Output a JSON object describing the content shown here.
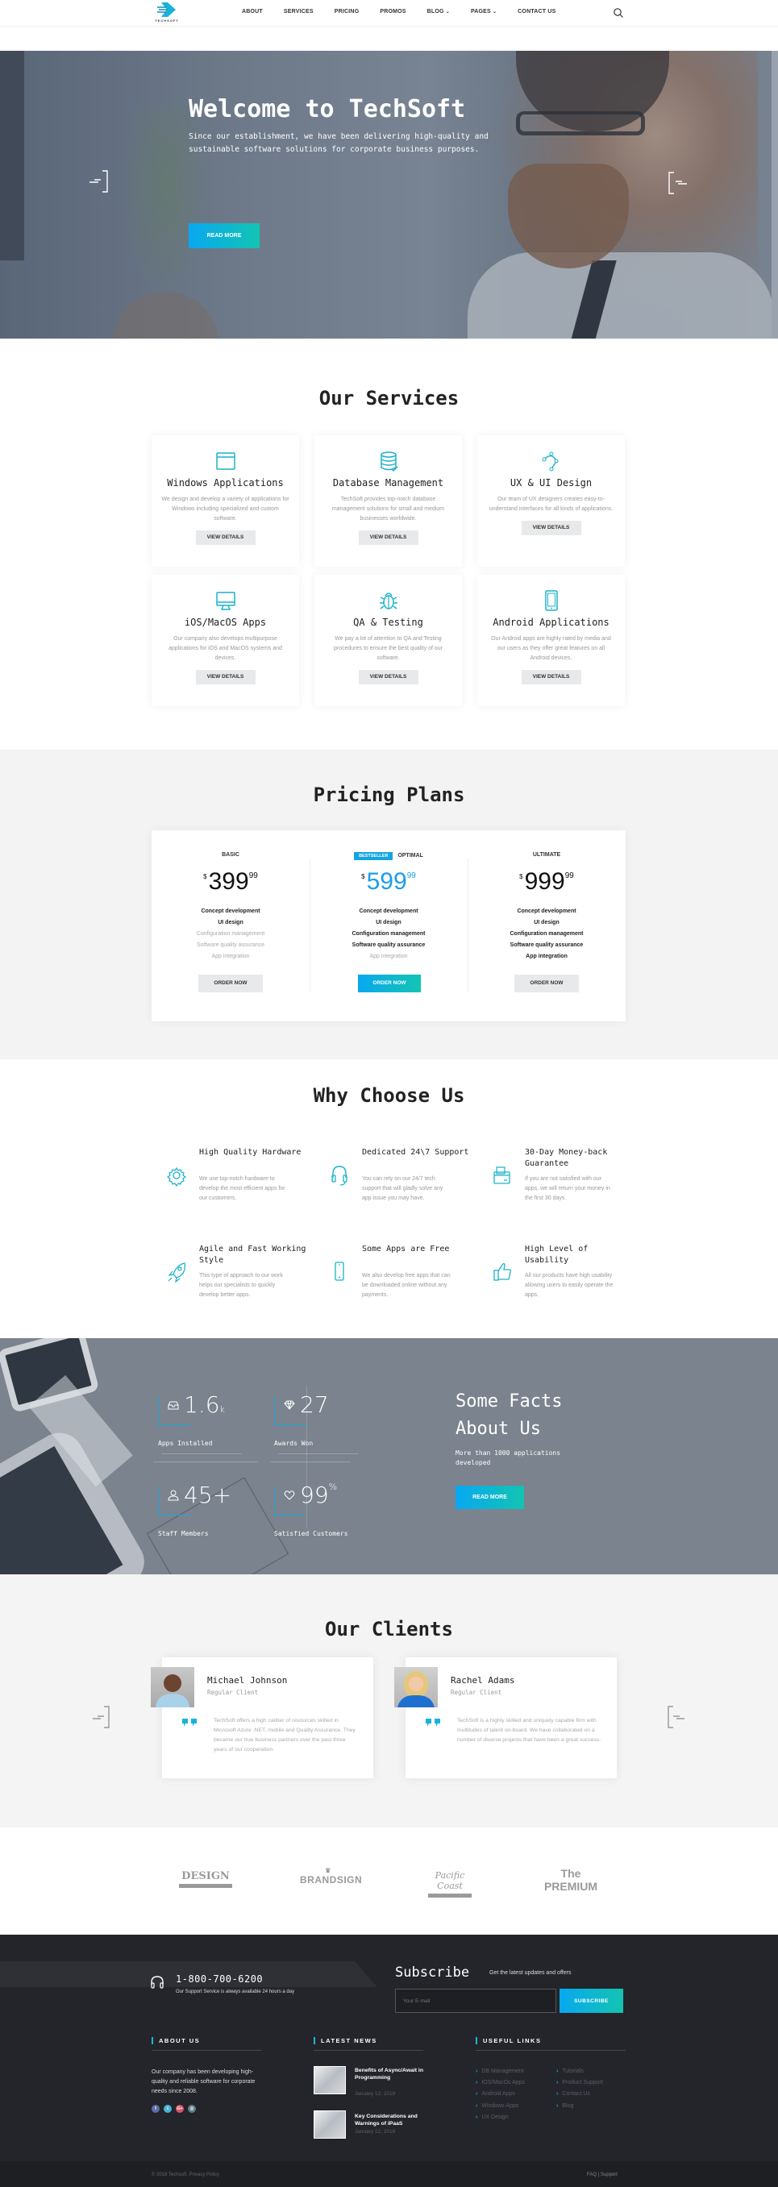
{
  "header": {
    "logo_text": "TECHSOFT",
    "nav": [
      {
        "label": "ABOUT",
        "dropdown": false
      },
      {
        "label": "SERVICES",
        "dropdown": false
      },
      {
        "label": "PRICING",
        "dropdown": false
      },
      {
        "label": "PROMOS",
        "dropdown": false
      },
      {
        "label": "BLOG",
        "dropdown": true
      },
      {
        "label": "PAGES",
        "dropdown": true
      },
      {
        "label": "CONTACT US",
        "dropdown": false
      }
    ],
    "search_icon": "search-icon"
  },
  "hero": {
    "title": "Welcome to TechSoft",
    "text": "Since our establishment, we have been delivering high-quality and sustainable software solutions for corporate business purposes.",
    "button": "READ MORE"
  },
  "services": {
    "title": "Our Services",
    "button_label": "VIEW DETAILS",
    "items": [
      {
        "icon": "window-icon",
        "title": "Windows Applications",
        "desc": "We design and develop a variety of applications for Windows including specialized and custom software."
      },
      {
        "icon": "database-icon",
        "title": "Database Management",
        "desc": "TechSoft provides top-notch database management solutions for small and medium businesses worldwide."
      },
      {
        "icon": "vector-path-icon",
        "title": "UX & UI Design",
        "desc": "Our team of UX designers creates easy-to-understand interfaces for all kinds of applications."
      },
      {
        "icon": "monitor-icon",
        "title": "iOS/MacOS Apps",
        "desc": "Our company also develops multipurpose applications for iOS and MacOS systems and devices."
      },
      {
        "icon": "bug-icon",
        "title": "QA & Testing",
        "desc": "We pay a lot of attention to QA and Testing procedures to ensure the best quality of our software."
      },
      {
        "icon": "tablet-icon",
        "title": "Android Applications",
        "desc": "Our Android apps are highly rated by media and our users as they offer great features on all Android devices."
      }
    ]
  },
  "pricing": {
    "title": "Pricing Plans",
    "currency": "$",
    "order_label": "ORDER NOW",
    "badge": "BESTSELLER",
    "plans": [
      {
        "name": "BASIC",
        "price": "399",
        "cents": "99",
        "highlight": false,
        "features": [
          {
            "label": "Concept development",
            "included": true
          },
          {
            "label": "UI design",
            "included": true
          },
          {
            "label": "Configuration management",
            "included": false
          },
          {
            "label": "Software quality assurance",
            "included": false
          },
          {
            "label": "App integration",
            "included": false
          }
        ]
      },
      {
        "name": "OPTIMAL",
        "price": "599",
        "cents": "99",
        "highlight": true,
        "features": [
          {
            "label": "Concept development",
            "included": true
          },
          {
            "label": "UI design",
            "included": true
          },
          {
            "label": "Configuration management",
            "included": true
          },
          {
            "label": "Software quality assurance",
            "included": true
          },
          {
            "label": "App integration",
            "included": false
          }
        ]
      },
      {
        "name": "ULTIMATE",
        "price": "999",
        "cents": "99",
        "highlight": false,
        "features": [
          {
            "label": "Concept development",
            "included": true
          },
          {
            "label": "UI design",
            "included": true
          },
          {
            "label": "Configuration management",
            "included": true
          },
          {
            "label": "Software quality assurance",
            "included": true
          },
          {
            "label": "App integration",
            "included": true
          }
        ]
      }
    ]
  },
  "why": {
    "title": "Why Choose Us",
    "items": [
      {
        "icon": "gear-icon",
        "title": "High Quality Hardware",
        "desc": "We use top-notch hardware to develop the most efficient apps for our customers."
      },
      {
        "icon": "headset-icon",
        "title": "Dedicated 24\\7 Support",
        "desc": "You can rely on our 24/7 tech support that will gladly solve any app issue you may have."
      },
      {
        "icon": "wallet-icon",
        "title": "30-Day Money-back Guarantee",
        "desc": "If you are not satisfied with our apps, we will return your money in the first 30 days."
      },
      {
        "icon": "rocket-icon",
        "title": "Agile and Fast Working Style",
        "desc": "This type of approach to our work helps our specialists to quickly develop better apps."
      },
      {
        "icon": "smartphone-icon",
        "title": "Some Apps are Free",
        "desc": "We also develop free apps that can be downloaded online without any payments."
      },
      {
        "icon": "thumbs-up-icon",
        "title": "High Level of Usability",
        "desc": "All our products have high usability allowing users to easily operate the apps."
      }
    ]
  },
  "facts": {
    "title_line1": "Some Facts",
    "title_line2": "About Us",
    "text": "More than 1000 applications developed",
    "button": "READ MORE",
    "items": [
      {
        "icon": "inbox-icon",
        "value": "1.6",
        "suffix": "k",
        "label": "Apps Installed"
      },
      {
        "icon": "diamond-icon",
        "value": "27",
        "suffix": "",
        "label": "Awards Won"
      },
      {
        "icon": "user-icon",
        "value": "45+",
        "suffix": "",
        "label": "Staff Members"
      },
      {
        "icon": "heart-icon",
        "value": "99",
        "suffix": "%",
        "label": "Satisfied Customers"
      }
    ]
  },
  "clients": {
    "title": "Our Clients",
    "items": [
      {
        "name": "Michael Johnson",
        "role": "Regular Client",
        "text": "TechSoft offers a high caliber of resources skilled in Microsoft Azure .NET, mobile and Quality Assurance. They became our true business partners over the past three years of our cooperation."
      },
      {
        "name": "Rachel Adams",
        "role": "Regular Client",
        "text": "TechSoft is a highly skilled and uniquely capable firm with multitudes of talent on-board. We have collaborated on a number of diverse projects that have been a great success."
      }
    ]
  },
  "brands": [
    "DESIGN",
    "BRANDSIGN",
    "Pacific Coast",
    "The PREMIUM"
  ],
  "footer": {
    "phone": "1-800-700-6200",
    "phone_sub": "Our Support Service is always available 24 hours a day",
    "subscribe_title": "Subscribe",
    "subscribe_text": "Get the latest updates and offers",
    "email_placeholder": "Your E-mail",
    "subscribe_button": "SUBSCRIBE",
    "about_title": "ABOUT US",
    "about_text": "Our company has been developing high-quality and reliable software for corporate needs since 2008.",
    "social": [
      {
        "icon": "facebook-icon",
        "glyph": "f",
        "color": "#5b6fa8"
      },
      {
        "icon": "twitter-icon",
        "glyph": "t",
        "color": "#4ab3d6"
      },
      {
        "icon": "google-plus-icon",
        "glyph": "G+",
        "color": "#d5566a"
      },
      {
        "icon": "instagram-icon",
        "glyph": "◎",
        "color": "#5f7f88"
      }
    ],
    "news_title": "LATEST NEWS",
    "news": [
      {
        "title": "Benefits of Async/Await in Programming",
        "date": "January 12, 2018"
      },
      {
        "title": "Key Considerations and Warnings of iPaaS",
        "date": "January 12, 2018"
      }
    ],
    "links_title": "USEFUL LINKS",
    "links_col1": [
      "DB Management",
      "IOS/MacOs Apps",
      "Android Apps",
      "Windows Apps",
      "UX Design"
    ],
    "links_col2": [
      "Tutorials",
      "Product Support",
      "Contact Us",
      "Blog"
    ],
    "copyright": "© 2018 Techsoft. Privacy Policy",
    "bottom_links": "FAQ | Support"
  },
  "colors": {
    "accent": "#13a5e0",
    "accent2": "#13c4b2",
    "footer_bg": "#24252a"
  }
}
